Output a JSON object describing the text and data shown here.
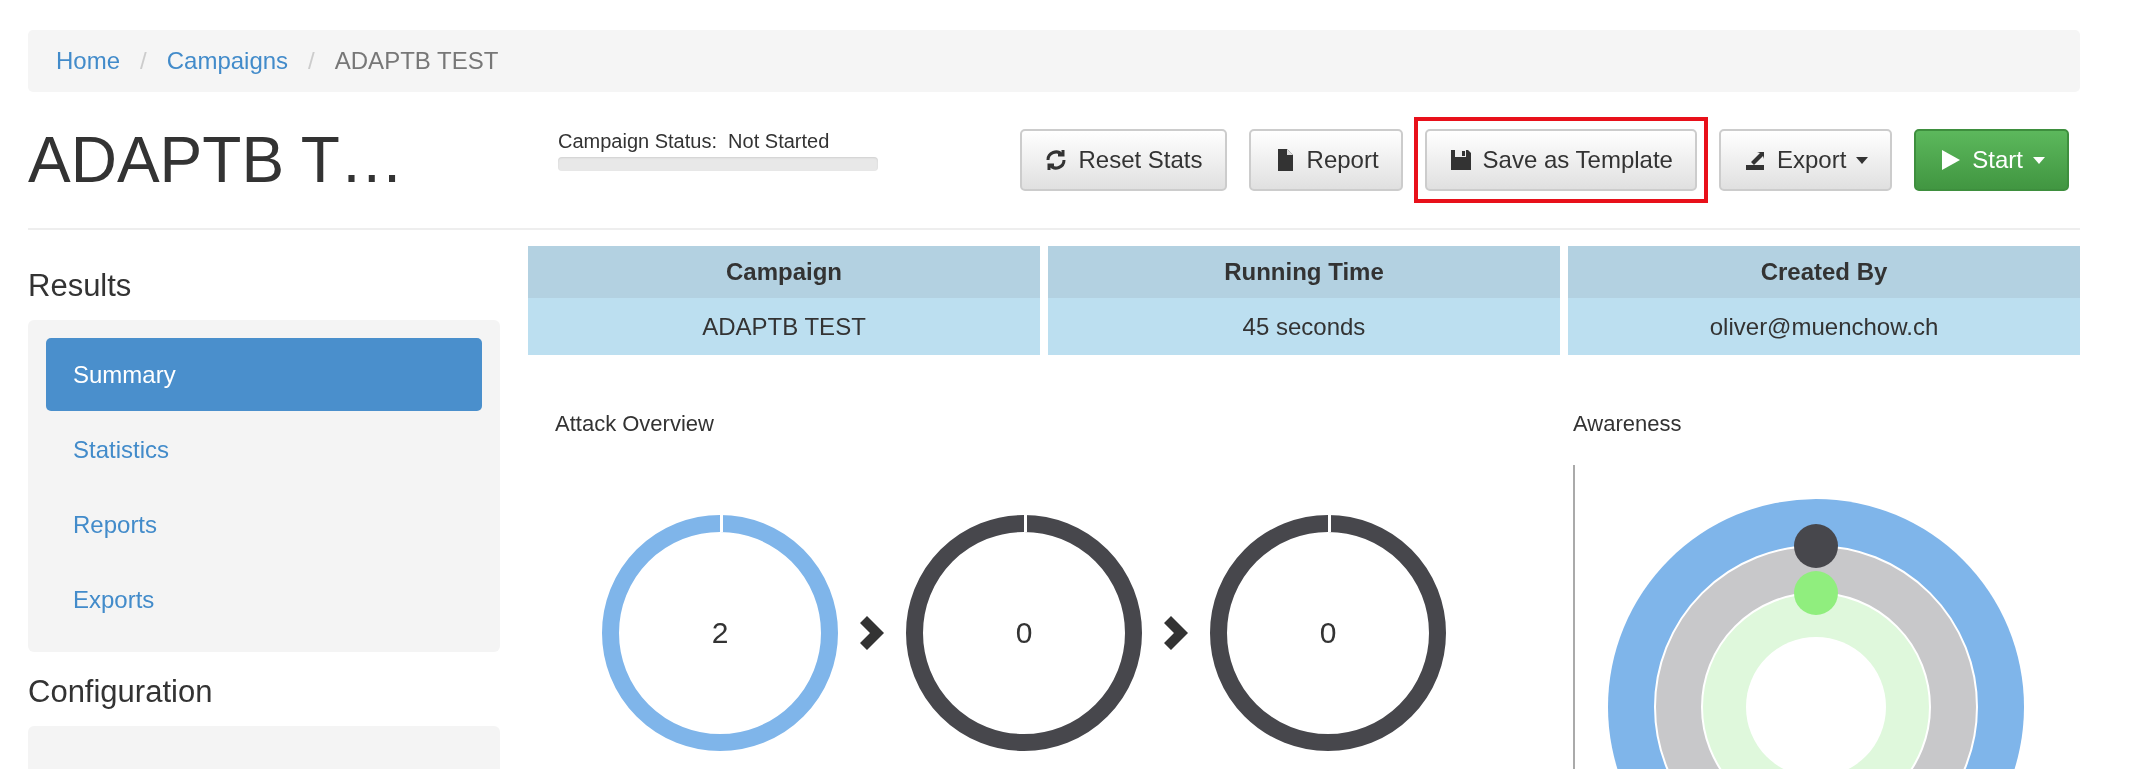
{
  "breadcrumb": [
    {
      "label": "Home",
      "link": true
    },
    {
      "label": "Campaigns",
      "link": true
    },
    {
      "label": "ADAPTB TEST",
      "link": false
    }
  ],
  "separator": "/",
  "title": "ADAPTB T…",
  "status": {
    "label": "Campaign Status:",
    "value": "Not Started",
    "level": 0
  },
  "actions": [
    {
      "kind": "reset",
      "label": "Reset Stats",
      "highlighted": false,
      "dropdown": false,
      "primary": false
    },
    {
      "kind": "report",
      "label": "Report",
      "highlighted": false,
      "dropdown": false,
      "primary": false
    },
    {
      "kind": "save",
      "label": "Save as Template",
      "highlighted": true,
      "dropdown": false,
      "primary": false
    },
    {
      "kind": "export",
      "label": "Export",
      "highlighted": false,
      "dropdown": true,
      "primary": false
    },
    {
      "kind": "start",
      "label": "Start",
      "highlighted": false,
      "dropdown": true,
      "primary": true
    }
  ],
  "sidebar": {
    "sections": [
      {
        "title": "Results",
        "items": [
          {
            "label": "Summary",
            "selected": true
          },
          {
            "label": "Statistics",
            "selected": false
          },
          {
            "label": "Reports",
            "selected": false
          },
          {
            "label": "Exports",
            "selected": false
          }
        ]
      },
      {
        "title": "Configuration"
      }
    ]
  },
  "info_table": {
    "columns": [
      "Campaign",
      "Running Time",
      "Created By"
    ],
    "values": [
      "ADAPTB TEST",
      "45 seconds",
      "oliver@muenchow.ch"
    ]
  },
  "attack_overview": {
    "title": "Attack Overview",
    "stages": [
      {
        "value": "2",
        "color": "#7fb5ea"
      },
      {
        "value": "0",
        "color": "#47474c"
      },
      {
        "value": "0",
        "color": "#47474c"
      }
    ]
  },
  "awareness": {
    "title": "Awareness",
    "rings": [
      {
        "color": "#7fb5ea"
      },
      {
        "color": "#c8c8ca"
      },
      {
        "color": "#dff8dc"
      }
    ],
    "markers": [
      {
        "color": "#47474c"
      },
      {
        "color": "#90ee7e"
      }
    ]
  }
}
